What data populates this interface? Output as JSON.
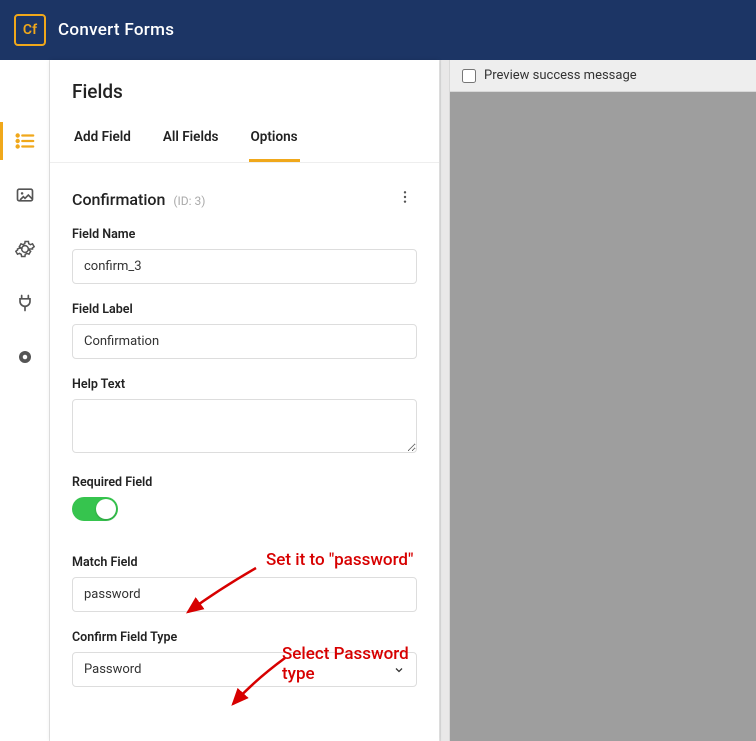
{
  "app": {
    "logo_text": "Cf",
    "title": "Convert Forms"
  },
  "panel": {
    "heading": "Fields",
    "tabs": {
      "add": "Add Field",
      "all": "All Fields",
      "options": "Options"
    }
  },
  "field": {
    "title": "Confirmation",
    "id_label": "(ID: 3)",
    "name": {
      "label": "Field Name",
      "value": "confirm_3"
    },
    "label": {
      "label": "Field Label",
      "value": "Confirmation"
    },
    "help": {
      "label": "Help Text",
      "value": ""
    },
    "required": {
      "label": "Required Field"
    },
    "match": {
      "label": "Match Field",
      "value": "password"
    },
    "type": {
      "label": "Confirm Field Type",
      "value": "Password"
    }
  },
  "preview": {
    "checkbox_label": "Preview success message"
  },
  "annotations": {
    "a1": "Set it to \"password\"",
    "a2": "Select Password type"
  }
}
